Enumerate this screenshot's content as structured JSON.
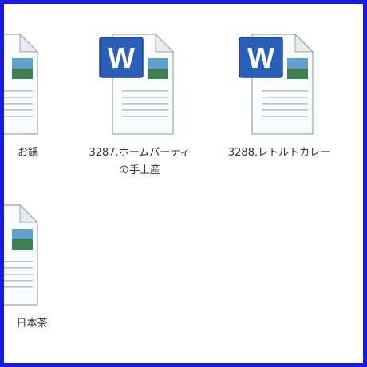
{
  "files": [
    {
      "label": "お鍋",
      "has_word_logo": false
    },
    {
      "label": "3287.ホームパーティの手土産",
      "has_word_logo": true
    },
    {
      "label": "3288.レトルトカレー",
      "has_word_logo": true
    },
    {
      "label": "日本茶",
      "has_word_logo": false
    }
  ],
  "icons": {
    "document": "word-document-icon",
    "logo_letter": "W"
  },
  "colors": {
    "border": "#1a1ae6",
    "word_blue": "#2a5fb5",
    "text": "#333333"
  }
}
